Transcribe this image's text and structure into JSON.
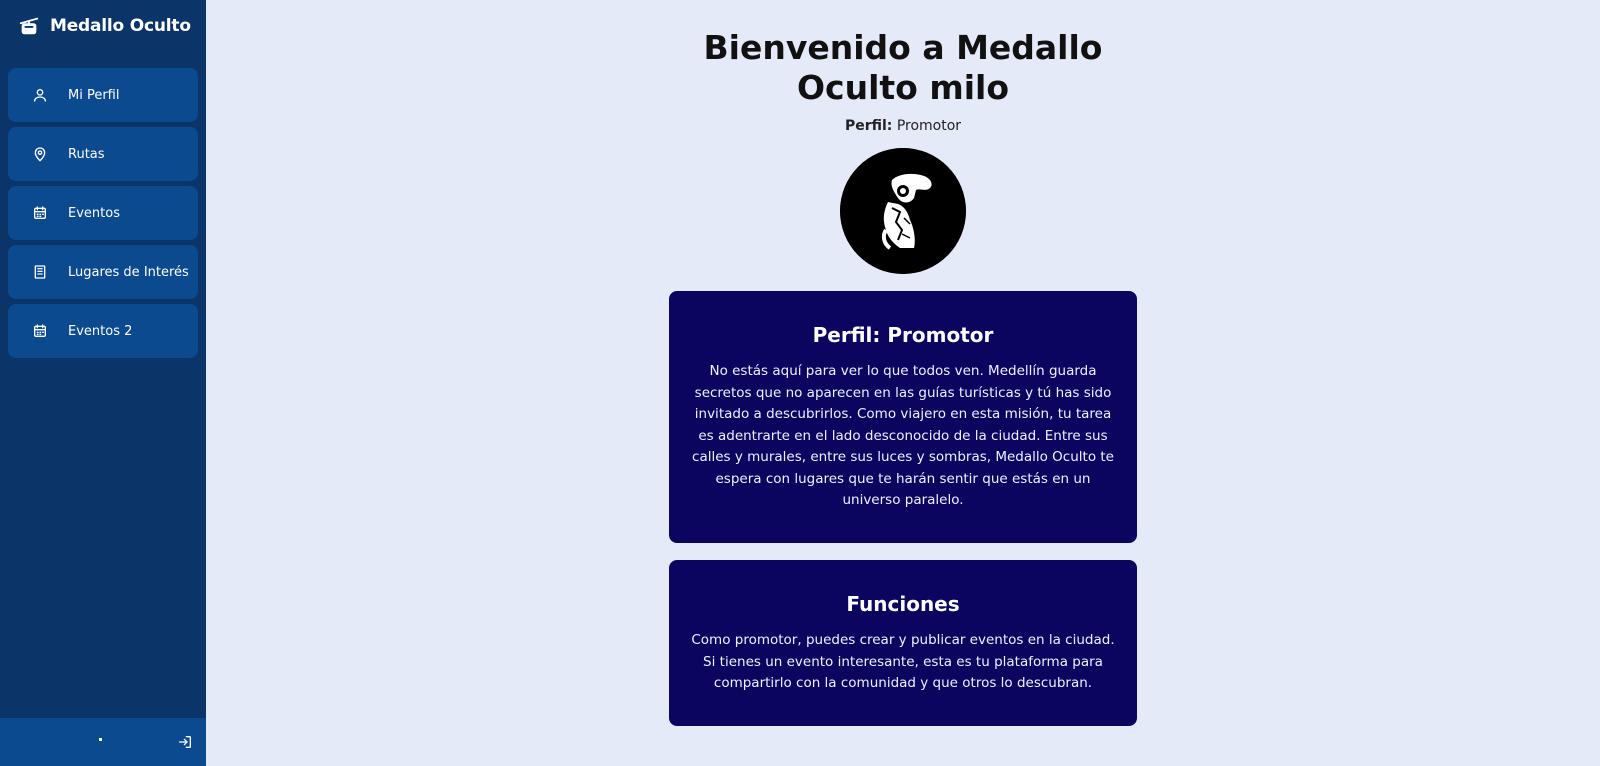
{
  "app": {
    "title": "Medallo Oculto",
    "logo_icon": "cable-car-icon"
  },
  "sidebar": {
    "items": [
      {
        "label": "Mi Perfil",
        "icon": "user-icon"
      },
      {
        "label": "Rutas",
        "icon": "map-pin-icon"
      },
      {
        "label": "Eventos",
        "icon": "calendar-icon"
      },
      {
        "label": "Lugares de Interés",
        "icon": "building-icon"
      },
      {
        "label": "Eventos 2",
        "icon": "calendar-icon"
      }
    ],
    "footer": {
      "dot": "·",
      "logout_icon": "logout-icon"
    }
  },
  "main": {
    "title": "Bienvenido a Medallo Oculto milo",
    "profile_label": "Perfil:",
    "profile_value": "Promotor",
    "avatar_icon": "photographer-avatar",
    "cards": [
      {
        "title": "Perfil: Promotor",
        "text": "No estás aquí para ver lo que todos ven. Medellín guarda secretos que no aparecen en las guías turísticas y tú has sido invitado a descubrirlos. Como viajero en esta misión, tu tarea es adentrarte en el lado desconocido de la ciudad. Entre sus calles y murales, entre sus luces y sombras, Medallo Oculto te espera con lugares que te harán sentir que estás en un universo paralelo."
      },
      {
        "title": "Funciones",
        "text": "Como promotor, puedes crear y publicar eventos en la ciudad. Si tienes un evento interesante, esta es tu plataforma para compartirlo con la comunidad y que otros lo descubran."
      }
    ]
  },
  "colors": {
    "sidebar_bg": "#0b3568",
    "nav_item_bg": "#0b4a8f",
    "page_bg": "#e4eaf7",
    "card_bg": "#0a0660"
  }
}
